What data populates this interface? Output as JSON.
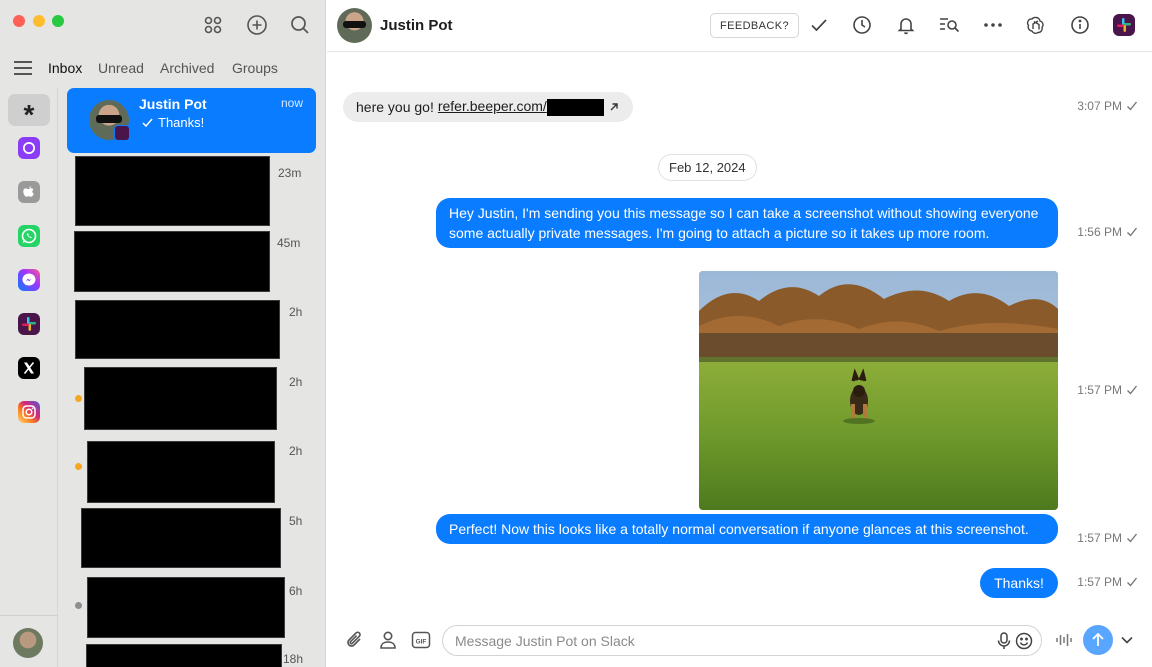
{
  "sidebar": {
    "tabs": [
      "Inbox",
      "Unread",
      "Archived",
      "Groups"
    ],
    "rail": [
      "all-chats",
      "beeper",
      "imessage",
      "whatsapp",
      "messenger",
      "slack",
      "x",
      "instagram"
    ],
    "active_chat": {
      "name": "Justin Pot",
      "time": "now",
      "preview": "Thanks!"
    },
    "chat_times": [
      "23m",
      "45m",
      "2h",
      "2h",
      "2h",
      "5h",
      "6h",
      "18h"
    ]
  },
  "header": {
    "name": "Justin Pot",
    "feedback_label": "FEEDBACK?"
  },
  "messages": {
    "incoming": {
      "prefix": "here you go!",
      "link": "refer.beeper.com/",
      "time": "3:07 PM"
    },
    "date_divider": "Feb 12, 2024",
    "outgoing": [
      {
        "text": "Hey Justin, I'm sending you this message so I can take a screenshot without showing everyone some actually private messages. I'm going to attach a picture so it takes up more room.",
        "time": "1:56 PM"
      },
      {
        "time": "1:57 PM"
      },
      {
        "text": "Perfect! Now this looks like a totally normal conversation if anyone glances at this screenshot.",
        "time": "1:57 PM"
      },
      {
        "text": "Thanks!",
        "time": "1:57 PM"
      }
    ]
  },
  "composer": {
    "placeholder": "Message Justin Pot on Slack",
    "gif_label": "GIF"
  },
  "colors": {
    "accent": "#0a7cff",
    "sidebar_bg": "#e5e5e4",
    "unread_orange": "#f5a623",
    "unread_gray": "#8e8e8e"
  }
}
